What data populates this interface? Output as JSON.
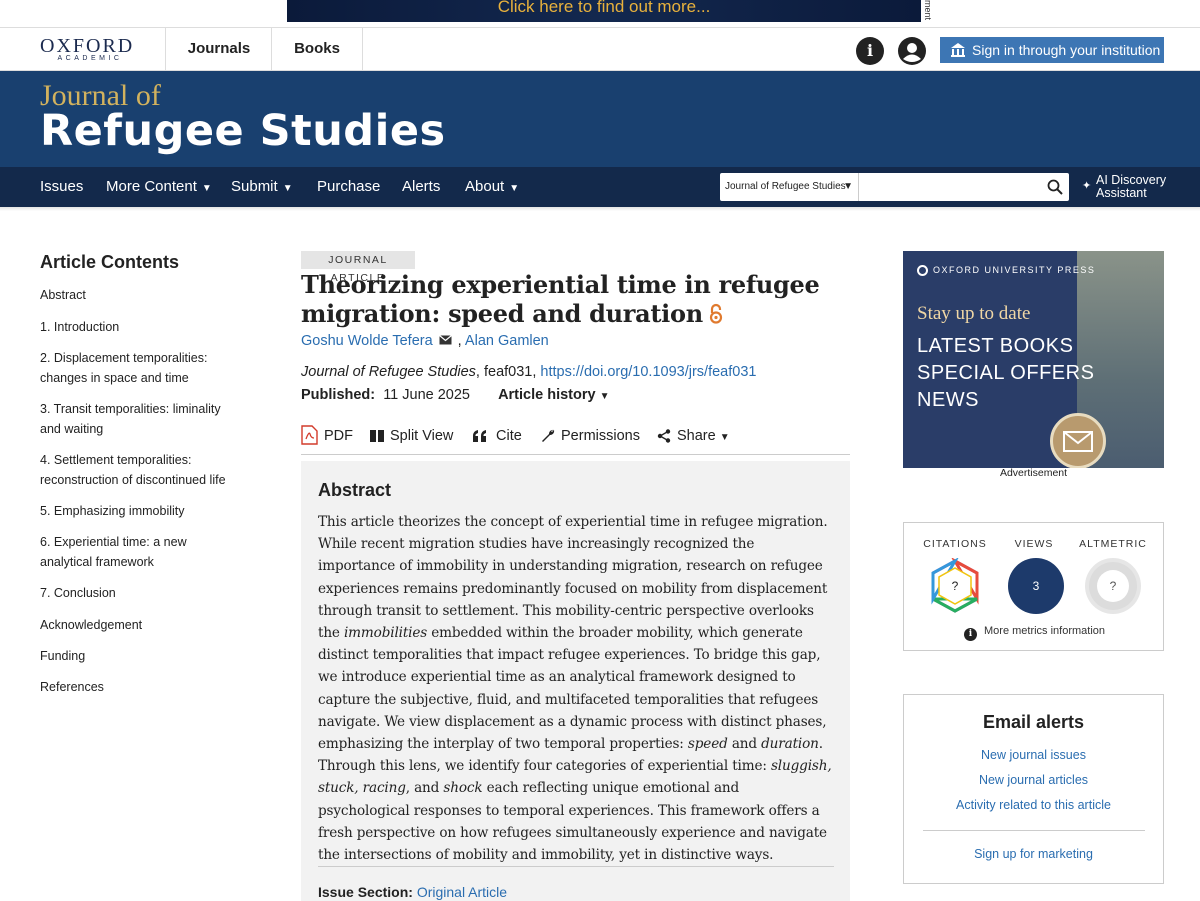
{
  "ad_banner": {
    "text": "Click here to find out more...",
    "side_text": "ment"
  },
  "topnav": {
    "logo_line1": "OXFORD",
    "logo_line2": "ACADEMIC",
    "journals": "Journals",
    "books": "Books",
    "info_glyph": "i",
    "signin": "Sign in through your institution"
  },
  "header": {
    "of": "Journal of",
    "title": "Refugee Studies"
  },
  "secnav": {
    "items": [
      "Issues",
      "More Content",
      "Submit",
      "Purchase",
      "Alerts",
      "About"
    ],
    "caret": "▼",
    "search_scope": "Journal of Refugee Studies",
    "search_placeholder": "",
    "ai_line1": "AI Discovery",
    "ai_line2": "Assistant"
  },
  "toc": {
    "heading": "Article Contents",
    "items": [
      "Abstract",
      "1. Introduction",
      "2. Displacement temporalities: changes in space and time",
      "3. Transit temporalities: liminality and waiting",
      "4. Settlement temporalities: reconstruction of discontinued life",
      "5. Emphasizing immobility",
      "6. Experiential time: a new analytical framework",
      "7. Conclusion",
      "Acknowledgement",
      "Funding",
      "References"
    ]
  },
  "article": {
    "badge": "JOURNAL ARTICLE",
    "title": "Theorizing experiential time in refugee migration: speed and duration",
    "author1": "Goshu Wolde Tefera",
    "author_sep": ",",
    "author2": "Alan Gamlen",
    "journal": "Journal of Refugee Studies",
    "article_id": ", feaf031, ",
    "doi": "https://doi.org/10.1093/jrs/feaf031",
    "published_label": "Published:",
    "published_date": "11 June 2025",
    "history": "Article history",
    "history_caret": "▼",
    "tools": {
      "pdf": "PDF",
      "split": "Split View",
      "cite": "Cite",
      "permissions": "Permissions",
      "share": "Share",
      "share_caret": "▼"
    }
  },
  "abstract": {
    "heading": "Abstract",
    "p1": "This article theorizes the concept of experiential time in refugee migration. While recent migration studies have increasingly recognized the importance of immobility in understanding migration, research on refugee experiences remains predominantly focused on mobility from displacement through transit to settlement. This mobility-centric perspective overlooks the ",
    "p1_em": "immobilities",
    "p2": " embedded within the broader mobility, which generate distinct temporalities that impact refugee experiences. To bridge this gap, we introduce experiential time as an analytical framework designed to capture the subjective, fluid, and multifaceted temporalities that refugees navigate. We view displacement as a dynamic process with distinct phases, emphasizing the interplay of two temporal properties: ",
    "speed": "speed",
    "and1": " and ",
    "duration": "duration",
    "p3": ". Through this lens, we identify four categories of experiential time: ",
    "sluggish": "sluggish",
    "c1": ", ",
    "stuck": "stuck",
    "c2": ", ",
    "racing": "racing",
    "and2": ", and ",
    "shock": "shock",
    "p4": " each reflecting unique emotional and psychological responses to temporal experiences. This framework offers a fresh perspective on how refugees simultaneously experience and navigate the intersections of mobility and immobility, yet in distinctive ways.",
    "issue_label": "Issue Section:",
    "issue_value": "Original Article"
  },
  "sidebar_ad": {
    "brand": "OXFORD UNIVERSITY PRESS",
    "tagline": "Stay up to date",
    "line1": "LATEST BOOKS",
    "line2": "SPECIAL OFFERS",
    "line3": "NEWS",
    "label": "Advertisement"
  },
  "metrics": {
    "citations_label": "CITATIONS",
    "citations_value": "?",
    "views_label": "VIEWS",
    "views_value": "3",
    "altmetric_label": "ALTMETRIC",
    "altmetric_value": "?",
    "more": "More metrics information",
    "views_color": "#1d3a6b"
  },
  "email_alerts": {
    "heading": "Email alerts",
    "links": [
      "New journal issues",
      "New journal articles",
      "Activity related to this article"
    ],
    "marketing": "Sign up for marketing"
  }
}
